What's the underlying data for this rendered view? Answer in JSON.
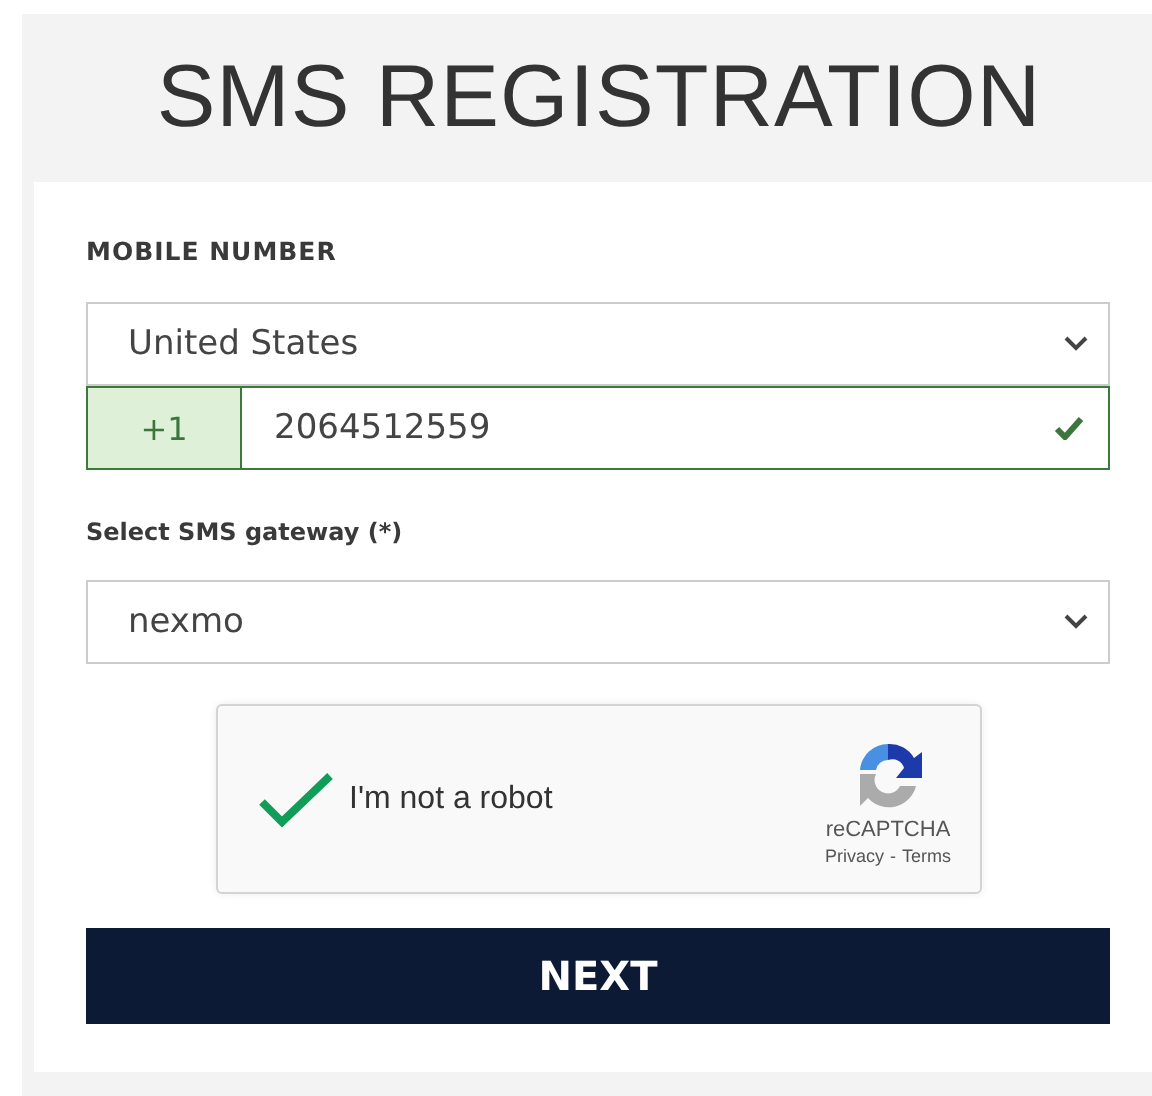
{
  "title": "SMS REGISTRATION",
  "mobile": {
    "label": "MOBILE NUMBER",
    "country": "United States",
    "prefix": "+1",
    "number": "2064512559",
    "valid": true
  },
  "gateway": {
    "label": "Select SMS gateway (*)",
    "value": "nexmo"
  },
  "captcha": {
    "label": "I'm not a robot",
    "checked": true,
    "brand": "reCAPTCHA",
    "privacy": "Privacy",
    "separator": "-",
    "terms": "Terms"
  },
  "submit": "NEXT"
}
